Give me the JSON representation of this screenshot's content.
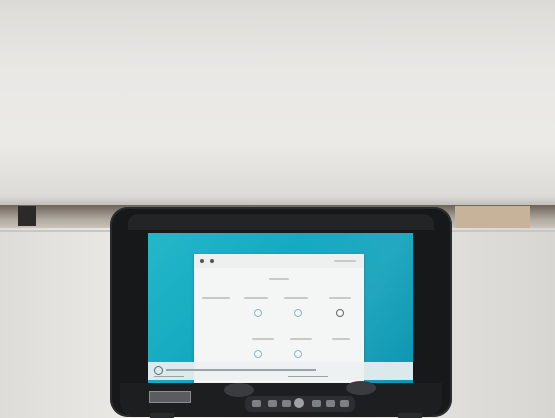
{
  "scene": {
    "description_type": "photo",
    "screen_state": "on",
    "colors": {
      "wall": "#e9e8e5",
      "device_body": "#171819",
      "screen_background": "#12a8bf",
      "dialog": "#f4f5f5"
    }
  }
}
